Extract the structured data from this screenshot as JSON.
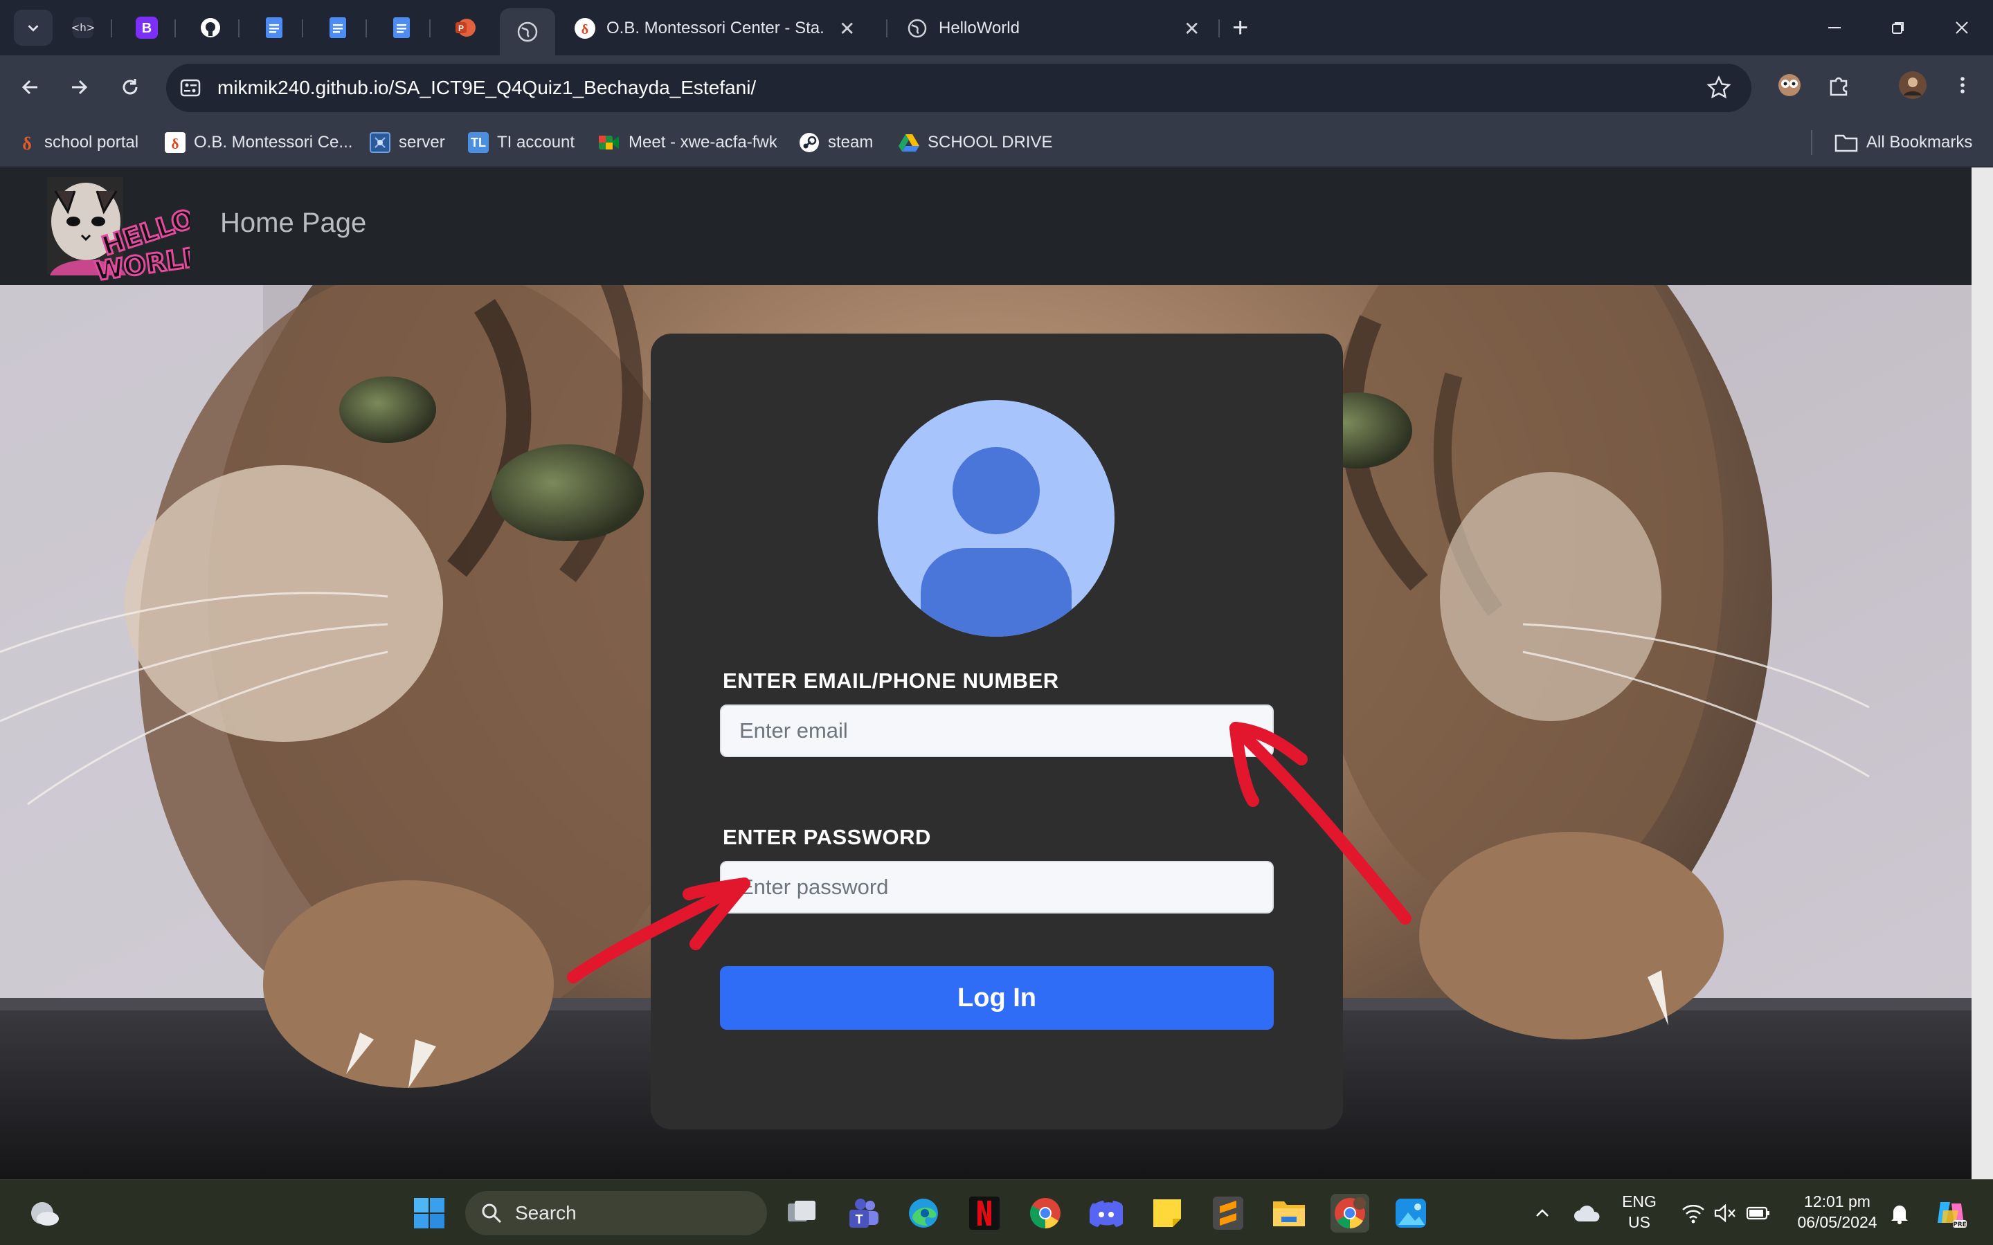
{
  "browser": {
    "tabs": [
      {
        "title": "O.B. Montessori Center - Sta. Ana"
      },
      {
        "title": "HelloWorld"
      }
    ],
    "address": "mikmik240.github.io/SA_ICT9E_Q4Quiz1_Bechayda_Estefani/",
    "bookmarks": [
      {
        "label": "school portal"
      },
      {
        "label": "O.B. Montessori Ce..."
      },
      {
        "label": "server"
      },
      {
        "label": "TI account",
        "icon_text": "TL"
      },
      {
        "label": "Meet - xwe-acfa-fwk"
      },
      {
        "label": "steam"
      },
      {
        "label": "SCHOOL DRIVE"
      }
    ],
    "all_bookmarks": "All Bookmarks"
  },
  "page": {
    "navbar": {
      "logo_text": "HELLO WORLD",
      "home_link": "Home Page"
    },
    "login": {
      "email_label": "ENTER EMAIL/PHONE NUMBER",
      "email_placeholder": "Enter email",
      "password_label": "ENTER PASSWORD",
      "password_placeholder": "Enter password",
      "button_label": "Log In"
    },
    "colors": {
      "card": "#2e2e2e",
      "button": "#2f6df6",
      "avatar_bg": "#a8c4fc",
      "avatar_fg": "#4b76d9",
      "annotation": "#e2172e"
    }
  },
  "taskbar": {
    "search_label": "Search",
    "language": "ENG",
    "region": "US",
    "time": "12:01 pm",
    "date": "06/05/2024"
  }
}
